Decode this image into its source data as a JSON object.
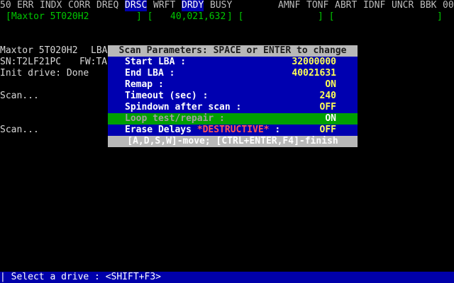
{
  "flags": {
    "f50": "50",
    "err": "ERR",
    "indx": "INDX",
    "corr": "CORR",
    "dreq": "DREQ",
    "drsc": "DRSC",
    "wrft": "WRFT",
    "drdy": "DRDY",
    "busy": "BUSY",
    "amnf": "AMNF",
    "tonf": "TONF",
    "abrt": "ABRT",
    "idnf": "IDNF",
    "uncr": "UNCR",
    "bbk": "BBK",
    "f00": "00"
  },
  "drive_bar": {
    "model": "[Maxtor 5T020H2",
    "bracket1": "] [",
    "capacity": "40,021,632",
    "bracket2": "] [",
    "bracket3": "] [",
    "bracket4": "]"
  },
  "info": {
    "model_line": "Maxtor 5T020H2",
    "lba_label": "LBA",
    "sn_line": "SN:T2LF21PC",
    "fw_label": "FW:TA",
    "init_line": "Init drive: Done",
    "scan1": "Scan...",
    "scan2": "Scan..."
  },
  "dialog": {
    "title": "Scan Parameters: SPACE or ENTER to change",
    "items": [
      {
        "label": "Start LBA :",
        "value": "32000000"
      },
      {
        "label": "End LBA :",
        "value": "40021631"
      },
      {
        "label": "Remap :",
        "value": "ON"
      },
      {
        "label": "Timeout (sec) :",
        "value": "240"
      },
      {
        "label": "Spindown after scan :",
        "value": "OFF"
      },
      {
        "label": "Loop test/repair :",
        "value": "ON"
      },
      {
        "label_a": "Erase Delays ",
        "label_b": "*DESTRUCTIVE*",
        "label_c": " :",
        "value": "OFF"
      }
    ],
    "footer": "[A,D,S,W]-move; [CTRL+ENTER,F4]-finish"
  },
  "status": {
    "text": "| Select a drive : <SHIFT+F3>"
  },
  "colors": {
    "background": "#000000",
    "dialog_body": "#0000b0",
    "dialog_title": "#b8b8b8",
    "selected_item": "#00a000",
    "value_text": "#ffff55",
    "destructive": "#ff5555",
    "statusbar": "#0000aa",
    "drive_capacity": "#00c800"
  }
}
